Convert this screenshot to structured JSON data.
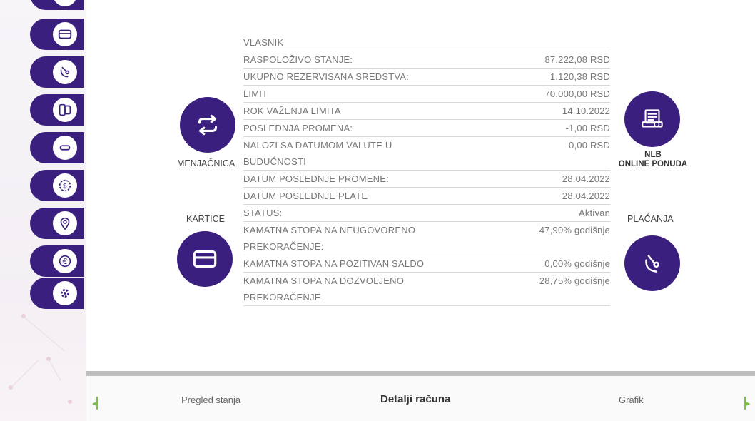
{
  "colors": {
    "accent": "#3a1f7f",
    "nav_green": "#7cc242"
  },
  "sidebar": {
    "items": [
      {
        "icon": "card-icon"
      },
      {
        "icon": "payments-icon"
      },
      {
        "icon": "devices-icon"
      },
      {
        "icon": "transfer-icon"
      },
      {
        "icon": "savings-icon"
      },
      {
        "icon": "location-icon"
      },
      {
        "icon": "euro-exchange-icon"
      },
      {
        "icon": "gear-icon"
      }
    ]
  },
  "details": {
    "rows": [
      {
        "label": "VLASNIK",
        "value": ""
      },
      {
        "label": "RASPOLOŽIVO STANJE:",
        "value": "87.222,08 RSD"
      },
      {
        "label": "UKUPNO REZERVISANA SREDSTVA:",
        "value": "1.120,38 RSD"
      },
      {
        "label": "LIMIT",
        "value": "70.000,00 RSD"
      },
      {
        "label": "ROK VAŽENJA LIMITA",
        "value": "14.10.2022"
      },
      {
        "label": "POSLEDNJA PROMENA:",
        "value": "-1,00 RSD"
      },
      {
        "label": "NALOZI SA DATUMOM VALUTE U BUDUĆNOSTI",
        "value": "0,00 RSD"
      },
      {
        "label": "DATUM POSLEDNJE PROMENE:",
        "value": "28.04.2022"
      },
      {
        "label": "DATUM POSLEDNJE PLATE",
        "value": "28.04.2022"
      },
      {
        "label": "STATUS:",
        "value": "Aktivan"
      },
      {
        "label": "KAMATNA STOPA NA NEUGOVORENO PREKORAČENJE:",
        "value": "47,90% godišnje"
      },
      {
        "label": "KAMATNA STOPA NA POZITIVAN SALDO",
        "value": "0,00% godišnje"
      },
      {
        "label": "KAMATNA STOPA NA DOZVOLJENO PREKORAČENJE",
        "value": "28,75% godišnje"
      }
    ]
  },
  "shortcuts": {
    "exchange": {
      "label": "MENJAČNICA",
      "icon": "exchange-arrows-icon"
    },
    "cards": {
      "label": "KARTICE",
      "icon": "card-icon"
    },
    "online_offer": {
      "label_line1": "NLB",
      "label_line2": "ONLINE PONUDA",
      "icon": "online-offer-icon"
    },
    "payments": {
      "label": "PLAĆANJA",
      "icon": "payments-icon"
    }
  },
  "bottom_nav": {
    "tabs": [
      {
        "label": "Pregled stanja"
      },
      {
        "label": "Detalji računa",
        "active": true
      },
      {
        "label": "Grafik"
      }
    ]
  }
}
